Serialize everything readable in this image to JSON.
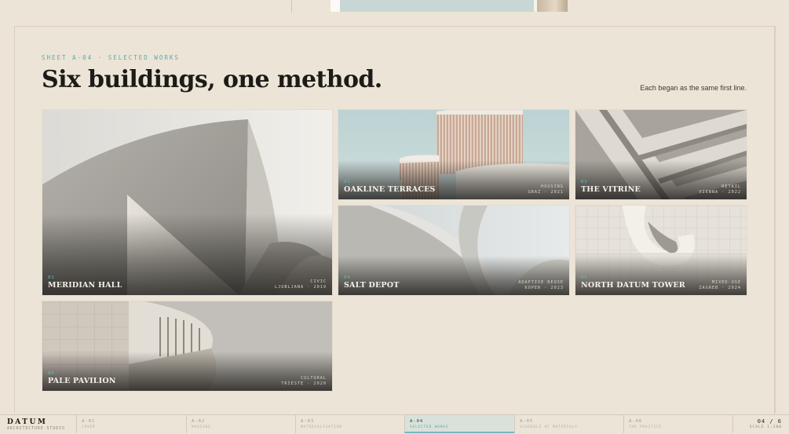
{
  "sheet": {
    "eyebrow": "SHEET A-04 · SELECTED WORKS",
    "title": "Six buildings, one method.",
    "tagline": "Each began as the same first line."
  },
  "projects": [
    {
      "num": "01",
      "name": "MERIDIAN HALL",
      "type": "CIVIC",
      "place": "LJUBLJANA · 2019"
    },
    {
      "num": "02",
      "name": "OAKLINE TERRACES",
      "type": "HOUSING",
      "place": "GRAZ · 2021"
    },
    {
      "num": "03",
      "name": "THE VITRINE",
      "type": "RETAIL",
      "place": "VIENNA · 2022"
    },
    {
      "num": "04",
      "name": "SALT DEPOT",
      "type": "ADAPTIVE REUSE",
      "place": "KOPER · 2023"
    },
    {
      "num": "05",
      "name": "NORTH DATUM TOWER",
      "type": "MIXED-USE",
      "place": "ZAGREB · 2024"
    },
    {
      "num": "06",
      "name": "PALE PAVILION",
      "type": "CULTURAL",
      "place": "TRIESTE · 2020"
    }
  ],
  "nav": {
    "brand": "DATUM",
    "brand_sub": "ARCHITECTURE STUDIO",
    "tabs": [
      {
        "code": "A-01",
        "label": "COVER"
      },
      {
        "code": "A-02",
        "label": "MASSING"
      },
      {
        "code": "A-03",
        "label": "MATERIALISATION"
      },
      {
        "code": "A-04",
        "label": "SELECTED WORKS"
      },
      {
        "code": "A-05",
        "label": "SCHEDULE OF MATERIALS"
      },
      {
        "code": "A-06",
        "label": "THE PRACTICE"
      }
    ],
    "active_tab": "A-04",
    "page": "04 / 6",
    "scale": "SCALE 1:200"
  },
  "colors": {
    "accent": "#5aa9b1",
    "background": "#ece4d6",
    "ink": "#1c1b18"
  }
}
